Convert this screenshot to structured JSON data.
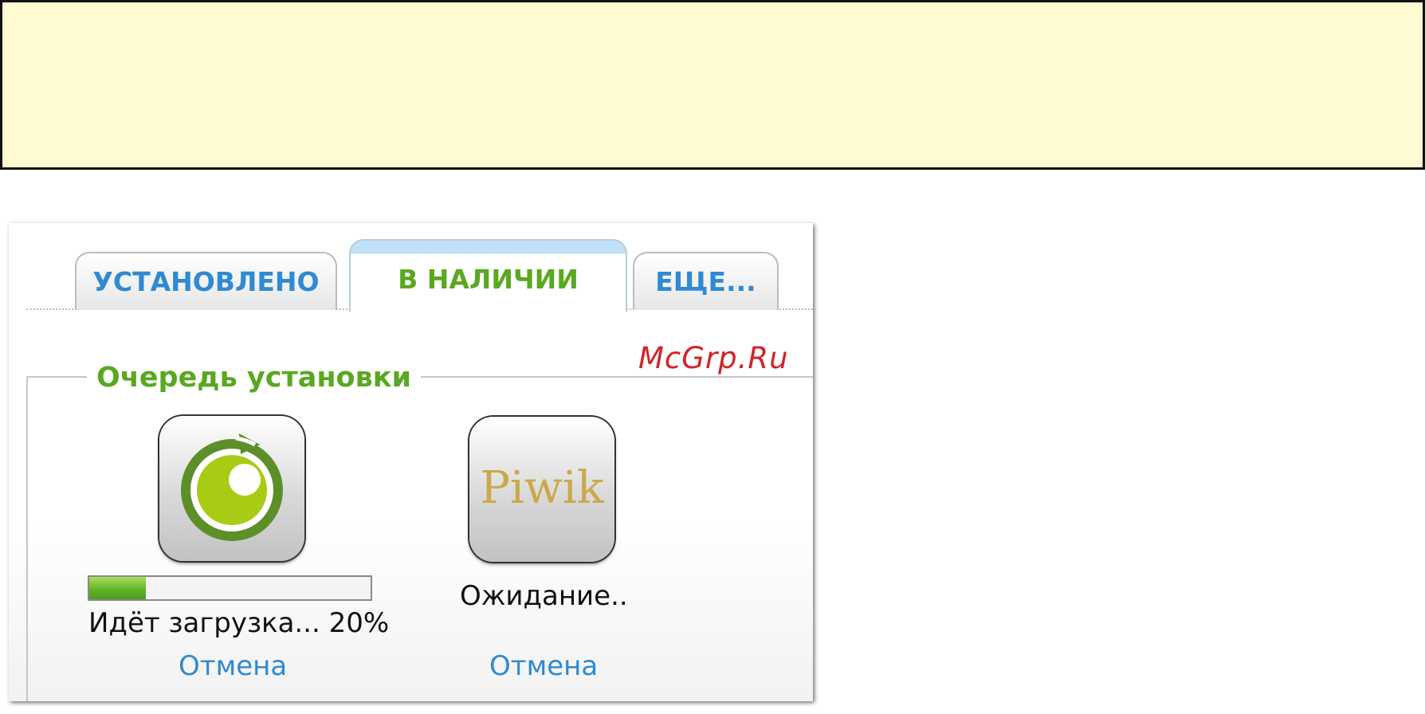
{
  "tabs": {
    "installed": "УСТАНОВЛЕНО",
    "available": "В НАЛИЧИИ",
    "more": "ЕЩЕ..."
  },
  "queue": {
    "title": "Очередь установки",
    "items": [
      {
        "icon": "eye-app-icon",
        "progress_percent": 20,
        "status": "Идёт загрузка... 20%",
        "cancel_label": "Отмена"
      },
      {
        "icon": "piwik-app-icon",
        "icon_text": "Piwik",
        "status": "Ожидание..",
        "cancel_label": "Отмена"
      }
    ]
  },
  "watermark": "McGrp.Ru",
  "colors": {
    "banner_bg": "#fffbd0",
    "tab_blue": "#2f8ad3",
    "tab_green": "#5aa821",
    "watermark_red": "#d2232a",
    "progress_green": "#5fb126"
  }
}
